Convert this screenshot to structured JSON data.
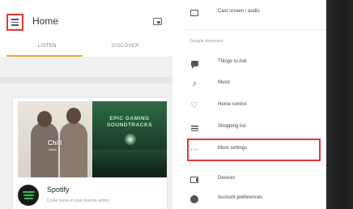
{
  "left_screen": {
    "header": {
      "title": "Home"
    },
    "tabs": [
      {
        "label": "LISTEN",
        "active": true
      },
      {
        "label": "DISCOVER",
        "active": false
      }
    ],
    "card": {
      "thumbnail_1": {
        "title": "Chill",
        "subtitle": "Vibes"
      },
      "thumbnail_2": {
        "title": "EPIC GAMING\nSOUNDTRACKS"
      },
      "service_name": "Spotify",
      "service_description": "Come home to your favorite artists"
    },
    "accent_color": "#f0a930",
    "highlight_color": "#e53935"
  },
  "right_screen": {
    "top_item": {
      "label": "Cast screen / audio",
      "icon": "cast-screen-icon"
    },
    "section_header": "Google Assistant",
    "items": [
      {
        "label": "Things to Ask",
        "icon": "chat-bubble-icon"
      },
      {
        "label": "Music",
        "icon": "music-note-icon"
      },
      {
        "label": "Home control",
        "icon": "lightbulb-icon"
      },
      {
        "label": "Shopping list",
        "icon": "list-icon"
      },
      {
        "label": "More settings",
        "icon": "more-horizontal-icon",
        "highlighted": true
      }
    ],
    "bottom_items": [
      {
        "label": "Devices",
        "icon": "devices-icon"
      },
      {
        "label": "Account preferences",
        "icon": "account-icon"
      }
    ]
  },
  "icons": {
    "music_glyph": "♪",
    "bulb_glyph": "♡",
    "more_glyph": "···"
  }
}
